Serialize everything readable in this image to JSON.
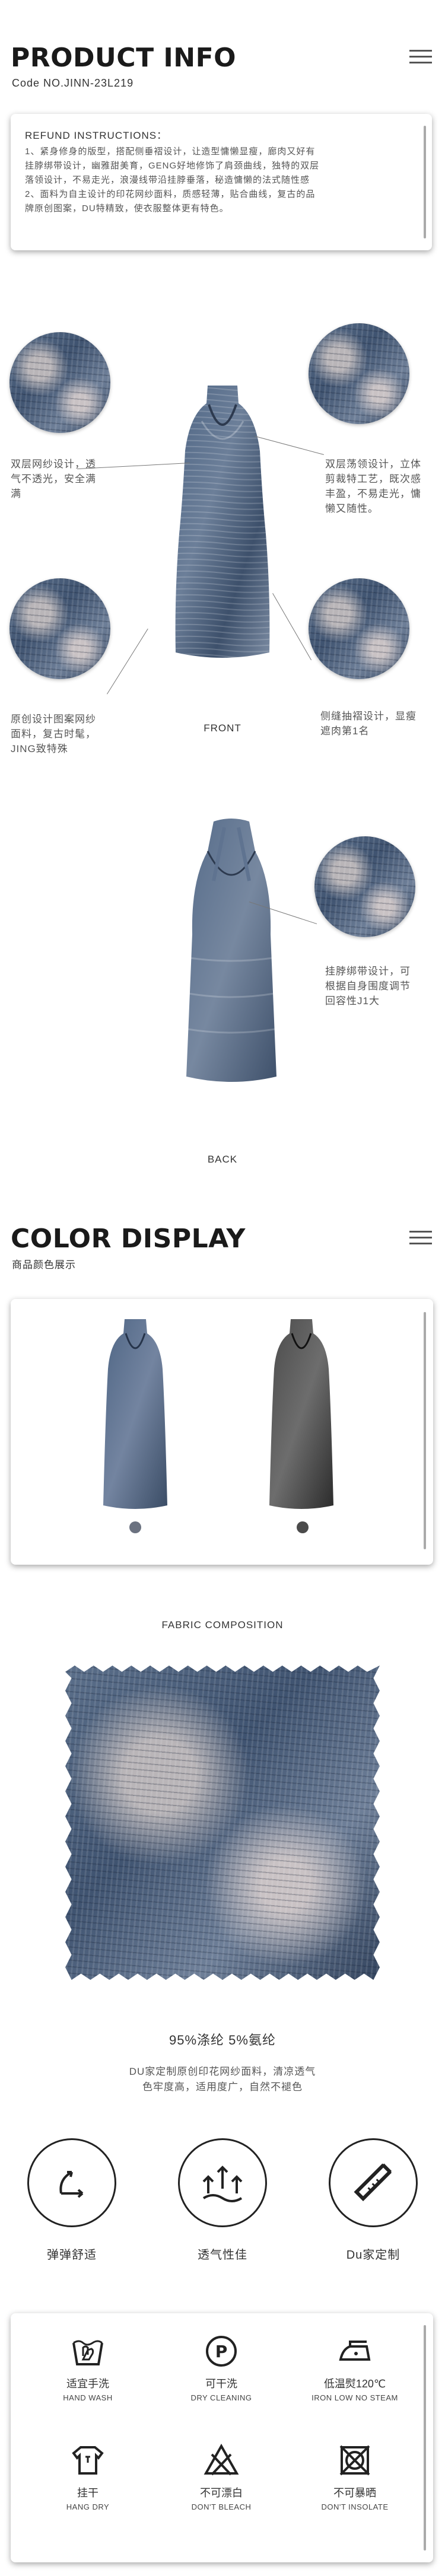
{
  "header": {
    "title": "PRODUCT INFO",
    "code": "Code NO.JINN-23L219"
  },
  "refund": {
    "title": "REFUND INSTRUCTIONS：",
    "line1": "1、紧身修身的版型，搭配侧垂褶设计，让造型慵懒显瘦，廊肉又好有",
    "line2": "挂脖绑带设计，幽雅甜美育，GENG好地修饰了肩颈曲线，独特的双层",
    "line3": "落领设计，不易走光，浪漫线带沿挂脖垂落，秘造慵懒的法式随性感",
    "line4": "2、面料为自主设计的印花网纱面料，质感轻薄，贴合曲线，复古的品",
    "line5": "牌原创图案，DU特精致，使衣服整体更有特色。"
  },
  "front": {
    "note_top_left": [
      "双层网纱设计，透",
      "气不透光，安全满",
      "满"
    ],
    "note_top_right": [
      "双层荡领设计，立体",
      "剪裁特工艺，既次感",
      "丰盈，不易走光，慵",
      "懒又随性。"
    ],
    "note_bottom_left": [
      "原创设计图案网纱",
      "面料，复古时髦，",
      "JING致特殊"
    ],
    "note_bottom_right": [
      "侧缝抽褶设计，显瘦",
      "遮肉第1名"
    ],
    "label": "FRONT"
  },
  "back": {
    "note_right": [
      "挂脖绑带设计，可",
      "根据自身围度调节",
      "回容性J1大"
    ],
    "label": "BACK"
  },
  "color_display": {
    "title": "COLOR DISPLAY",
    "subtitle": "商品颜色展示",
    "swatch_colors": [
      "#6b7280",
      "#4b4b4b"
    ]
  },
  "fabric": {
    "heading": "FABRIC COMPOSITION",
    "composition": "95%涤纶  5%氨纶",
    "desc_line1": "DU家定制原创印花网纱面料，清凉透气",
    "desc_line2": "色牢度高，适用度广，自然不褪色"
  },
  "features": [
    {
      "icon": "stretch-arrows-icon",
      "label": "弹弹舒适"
    },
    {
      "icon": "breathable-arrows-icon",
      "label": "透气性佳"
    },
    {
      "icon": "ruler-pencil-icon",
      "label": "Du家定制"
    }
  ],
  "care": [
    {
      "icon": "hand-wash-icon",
      "zh": "适宜手洗",
      "en": "HAND WASH"
    },
    {
      "icon": "dry-cleaning-icon",
      "zh": "可干洗",
      "en": "DRY CLEANING"
    },
    {
      "icon": "iron-low-icon",
      "zh": "低温熨120℃",
      "en": "IRON LOW NO STEAM"
    },
    {
      "icon": "hang-dry-icon",
      "zh": "挂干",
      "en": "HANG DRY"
    },
    {
      "icon": "no-bleach-icon",
      "zh": "不可漂白",
      "en": "DON'T BLEACH"
    },
    {
      "icon": "no-tumble-dry-icon",
      "zh": "不可暴晒",
      "en": "DON'T INSOLATE"
    }
  ]
}
